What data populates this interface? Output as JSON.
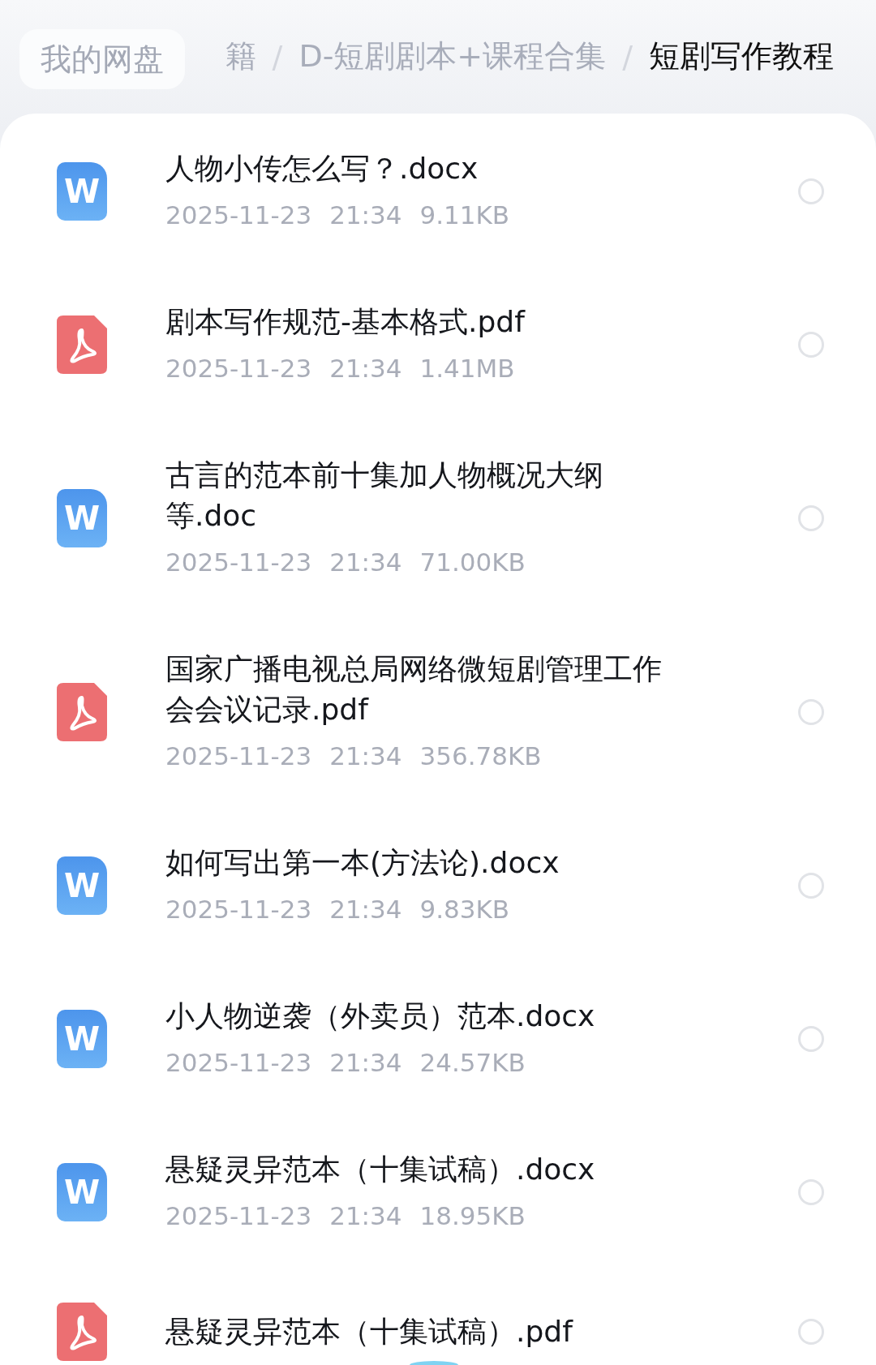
{
  "breadcrumb": {
    "root": "我的网盘",
    "separator": "/",
    "items": [
      {
        "label": "籍",
        "current": false
      },
      {
        "label": "D-短剧剧本+课程合集",
        "current": false
      },
      {
        "label": "短剧写作教程",
        "current": true
      }
    ]
  },
  "files": [
    {
      "kind": "word",
      "icon_text": "W",
      "name": "人物小传怎么写？.docx",
      "date": "2025-11-23",
      "time": "21:34",
      "size": "9.11KB",
      "selected": false
    },
    {
      "kind": "pdf",
      "name": "剧本写作规范-基本格式.pdf",
      "date": "2025-11-23",
      "time": "21:34",
      "size": "1.41MB",
      "selected": false
    },
    {
      "kind": "word",
      "icon_text": "W",
      "name": "古言的范本前十集加人物概况大纲等.doc",
      "date": "2025-11-23",
      "time": "21:34",
      "size": "71.00KB",
      "selected": false
    },
    {
      "kind": "pdf",
      "name": "国家广播电视总局网络微短剧管理工作会会议记录.pdf",
      "date": "2025-11-23",
      "time": "21:34",
      "size": "356.78KB",
      "selected": false
    },
    {
      "kind": "word",
      "icon_text": "W",
      "name": "如何写出第一本(方法论).docx",
      "date": "2025-11-23",
      "time": "21:34",
      "size": "9.83KB",
      "selected": false
    },
    {
      "kind": "word",
      "icon_text": "W",
      "name": "小人物逆袭（外卖员）范本.docx",
      "date": "2025-11-23",
      "time": "21:34",
      "size": "24.57KB",
      "selected": false
    },
    {
      "kind": "word",
      "icon_text": "W",
      "name": "悬疑灵异范本（十集试稿）.docx",
      "date": "2025-11-23",
      "time": "21:34",
      "size": "18.95KB",
      "selected": false
    },
    {
      "kind": "pdf",
      "name": "悬疑灵异范本（十集试稿）.pdf",
      "selected": false
    }
  ]
}
